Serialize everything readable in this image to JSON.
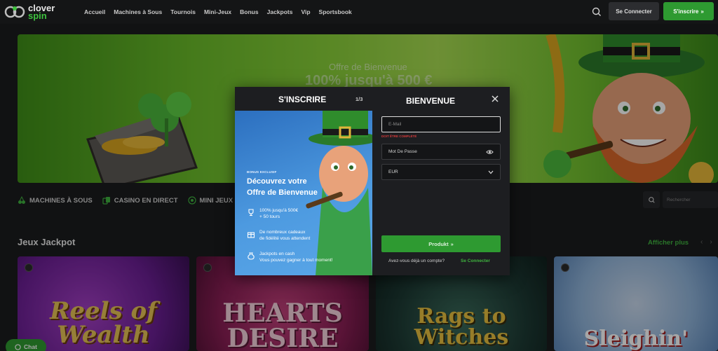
{
  "header": {
    "logo_line1": "clover",
    "logo_line2": "spin",
    "nav": [
      "Accueil",
      "Machines à Sous",
      "Tournois",
      "Mini-Jeux",
      "Bonus",
      "Jackpots",
      "Vip",
      "Sportsbook"
    ],
    "login_label": "Se Connecter",
    "signup_label": "S'inscrire"
  },
  "hero": {
    "subtitle": "Offre de Bienvenue",
    "headline": "100% jusqu'à 500 €"
  },
  "categories": [
    "MACHINES À SOUS",
    "CASINO EN DIRECT",
    "MINI JEUX"
  ],
  "category_search_placeholder": "Rechercher",
  "jackpot": {
    "title": "Jeux Jackpot",
    "see_more": "Afficher plus",
    "games": [
      "Reels of Wealth",
      "HEARTS DESIRE",
      "Rags to Witches",
      "Sleighin'"
    ]
  },
  "chat_label": "Chat",
  "modal": {
    "left_title": "S'INSCRIRE",
    "step": "1/3",
    "tag": "BONUS EXCLUSIF",
    "heading_line1": "Découvrez votre",
    "heading_line2": "Offre de Bienvenue",
    "features": [
      {
        "line1": "100% jusqu'à 500€",
        "line2": "+ 50 tours",
        "icon": "trophy-icon"
      },
      {
        "line1": "De nombreux cadeaux",
        "line2": "de fidélité vous attendent",
        "icon": "gift-icon"
      },
      {
        "line1": "Jackpots en cash",
        "line2": "Vous pouvez gagner à tout moment!",
        "icon": "money-bag-icon"
      }
    ],
    "right_title": "BIENVENUE",
    "email_placeholder": "E-Mail",
    "email_error": "DOIT ÊTRE COMPLÉTÉ",
    "password_placeholder": "Mot De Passe",
    "currency_value": "EUR",
    "next_label": "Produkt",
    "have_account": "Avez-vous déjà un compte?",
    "login_link": "Se Connecter"
  },
  "colors": {
    "accent_green": "#2e9a31",
    "link_green": "#3fb33f",
    "modal_blue": "#3e8ad8",
    "error_red": "#d63a3a"
  }
}
